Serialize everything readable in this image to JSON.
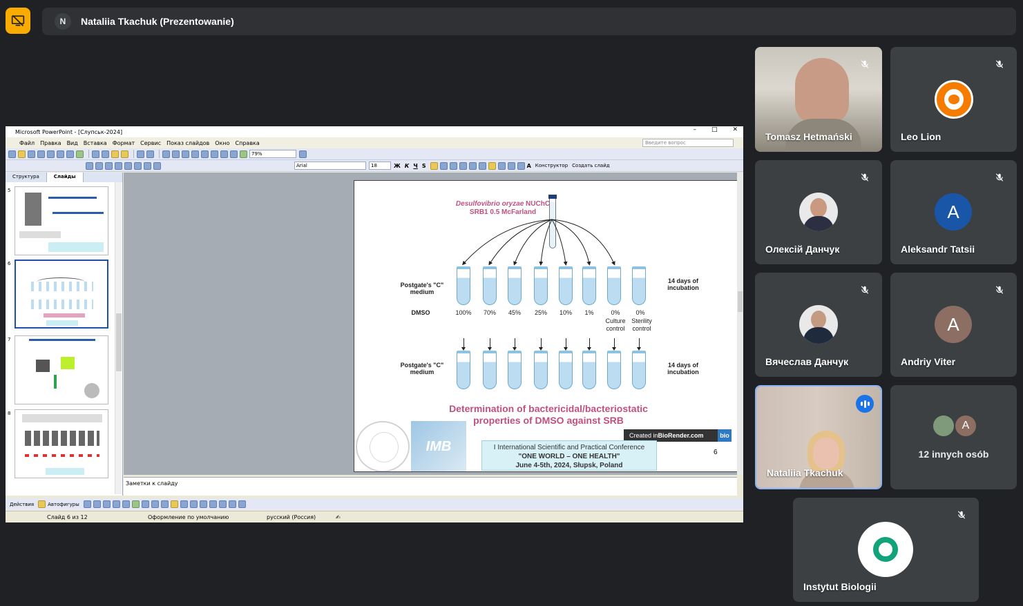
{
  "meet": {
    "presenter_initial": "N",
    "presenter_title": "Nataliia Tkachuk (Prezentowanie)",
    "accent": "#f9ab00"
  },
  "ppt": {
    "window_title": "Microsoft PowerPoint - [Слупськ-2024]",
    "menu": [
      "Файл",
      "Правка",
      "Вид",
      "Вставка",
      "Формат",
      "Сервис",
      "Показ слайдов",
      "Окно",
      "Справка"
    ],
    "help_placeholder": "Введите вопрос",
    "zoom": "79%",
    "font": "Arial",
    "font_size": "18",
    "designer": "Конструктор",
    "new_slide": "Создать слайд",
    "tabs": [
      "Структура",
      "Слайды"
    ],
    "thumbs": [
      {
        "num": "5"
      },
      {
        "num": "6"
      },
      {
        "num": "7"
      },
      {
        "num": "8"
      }
    ],
    "notes_placeholder": "Заметки к слайду",
    "actions": "Действия",
    "autoshapes": "Автофигуры",
    "status_slide": "Слайд 6 из 12",
    "status_design": "Оформление по умолчанию",
    "status_lang": "русский (Россия)"
  },
  "slide": {
    "culture_line1": "Desulfovibrio oryzae",
    "culture_line1b": " NUChC",
    "culture_line2": "SRB1 0.5 McFarland",
    "medium_label": "Postgate's \"C\" medium",
    "incubation_label": "14 days of incubation",
    "dmso_label": "DMSO",
    "concentrations": [
      "100%",
      "70%",
      "45%",
      "25%",
      "10%",
      "1%",
      "0%",
      "0%"
    ],
    "culture_control": "Culture control",
    "sterility_control": "Sterility control",
    "title": "Determination of bactericidal/bacteriostatic properties of DMSO against SRB",
    "biorender_prefix": "Created in ",
    "biorender_name": "BioRender.com",
    "biorender_logo": "bio",
    "imb_text": "IMB",
    "conf_line1": "I International Scientific and Practical Conference",
    "conf_line2": "\"ONE WORLD – ONE HEALTH\"",
    "conf_line3": "June 4-5th, 2024, Słupsk, Poland",
    "page_num": "6"
  },
  "participants": [
    {
      "name": "Tomasz Hetmański",
      "kind": "video"
    },
    {
      "name": "Leo Lion",
      "kind": "logo"
    },
    {
      "name": "Олексій Данчук",
      "kind": "photo"
    },
    {
      "name": "Aleksandr Tatsii",
      "kind": "letter",
      "letter": "A",
      "color": "#1a56a8"
    },
    {
      "name": "Вячеслав Данчук",
      "kind": "photo"
    },
    {
      "name": "Andriy Viter",
      "kind": "letter",
      "letter": "A",
      "color": "#8d6e63"
    },
    {
      "name": "Nataliia Tkachuk",
      "kind": "video",
      "speaking": true
    },
    {
      "name": "12 innych osób",
      "kind": "group",
      "letter": "A"
    },
    {
      "name": "Instytut Biologii",
      "kind": "logo"
    }
  ]
}
